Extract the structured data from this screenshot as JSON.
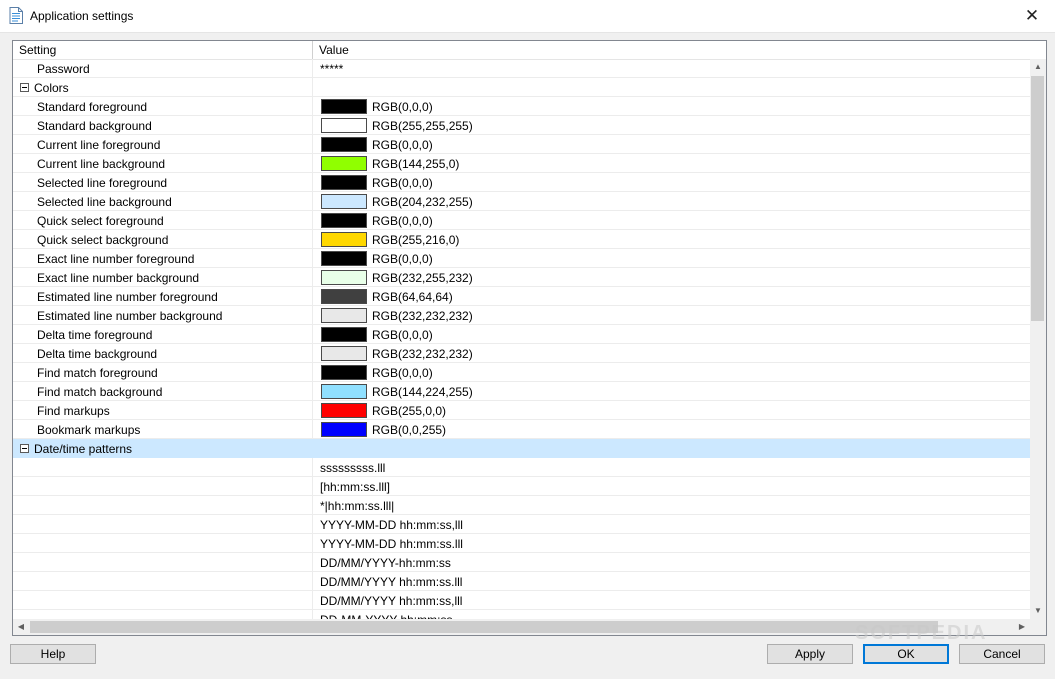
{
  "window": {
    "title": "Application settings",
    "close_glyph": "✕"
  },
  "grid": {
    "columns": [
      "Setting",
      "Value"
    ],
    "rows": [
      {
        "kind": "item",
        "name": "Password",
        "value": "*****"
      },
      {
        "kind": "category",
        "name": "Colors"
      },
      {
        "kind": "color",
        "name": "Standard foreground",
        "value": "RGB(0,0,0)",
        "color": "#000000"
      },
      {
        "kind": "color",
        "name": "Standard background",
        "value": "RGB(255,255,255)",
        "color": "#ffffff"
      },
      {
        "kind": "color",
        "name": "Current line foreground",
        "value": "RGB(0,0,0)",
        "color": "#000000"
      },
      {
        "kind": "color",
        "name": "Current line background",
        "value": "RGB(144,255,0)",
        "color": "#90ff00"
      },
      {
        "kind": "color",
        "name": "Selected line foreground",
        "value": "RGB(0,0,0)",
        "color": "#000000"
      },
      {
        "kind": "color",
        "name": "Selected line background",
        "value": "RGB(204,232,255)",
        "color": "#cce8ff"
      },
      {
        "kind": "color",
        "name": "Quick select foreground",
        "value": "RGB(0,0,0)",
        "color": "#000000"
      },
      {
        "kind": "color",
        "name": "Quick select background",
        "value": "RGB(255,216,0)",
        "color": "#ffd800"
      },
      {
        "kind": "color",
        "name": "Exact line number foreground",
        "value": "RGB(0,0,0)",
        "color": "#000000"
      },
      {
        "kind": "color",
        "name": "Exact line number background",
        "value": "RGB(232,255,232)",
        "color": "#e8ffe8"
      },
      {
        "kind": "color",
        "name": "Estimated line number foreground",
        "value": "RGB(64,64,64)",
        "color": "#404040"
      },
      {
        "kind": "color",
        "name": "Estimated line number background",
        "value": "RGB(232,232,232)",
        "color": "#e8e8e8"
      },
      {
        "kind": "color",
        "name": "Delta time foreground",
        "value": "RGB(0,0,0)",
        "color": "#000000"
      },
      {
        "kind": "color",
        "name": "Delta time background",
        "value": "RGB(232,232,232)",
        "color": "#e8e8e8"
      },
      {
        "kind": "color",
        "name": "Find match foreground",
        "value": "RGB(0,0,0)",
        "color": "#000000"
      },
      {
        "kind": "color",
        "name": "Find match background",
        "value": "RGB(144,224,255)",
        "color": "#90e0ff"
      },
      {
        "kind": "color",
        "name": "Find markups",
        "value": "RGB(255,0,0)",
        "color": "#ff0000"
      },
      {
        "kind": "color",
        "name": "Bookmark markups",
        "value": "RGB(0,0,255)",
        "color": "#0000ff"
      },
      {
        "kind": "category",
        "name": "Date/time patterns",
        "selected": true
      },
      {
        "kind": "item",
        "name": "",
        "value": "sssssssss.lll"
      },
      {
        "kind": "item",
        "name": "",
        "value": "[hh:mm:ss.lll]"
      },
      {
        "kind": "item",
        "name": "",
        "value": "*|hh:mm:ss.lll|"
      },
      {
        "kind": "item",
        "name": "",
        "value": "YYYY-MM-DD hh:mm:ss,lll"
      },
      {
        "kind": "item",
        "name": "",
        "value": "YYYY-MM-DD hh:mm:ss.lll"
      },
      {
        "kind": "item",
        "name": "",
        "value": "DD/MM/YYYY-hh:mm:ss"
      },
      {
        "kind": "item",
        "name": "",
        "value": "DD/MM/YYYY hh:mm:ss.lll"
      },
      {
        "kind": "item",
        "name": "",
        "value": "DD/MM/YYYY hh:mm:ss,lll"
      },
      {
        "kind": "item",
        "name": "",
        "value": "DD-MM-YYYY hh:mm:ss"
      }
    ]
  },
  "buttons": {
    "help": "Help",
    "apply": "Apply",
    "ok": "OK",
    "cancel": "Cancel"
  },
  "watermark": "SOFTPEDIA",
  "icons": {
    "window": "document-icon",
    "scroll_up": "▲",
    "scroll_down": "▼",
    "scroll_left": "◀",
    "scroll_right": "▶"
  },
  "colors": {
    "selection": "#cce8ff",
    "default_button_border": "#0078d7"
  }
}
